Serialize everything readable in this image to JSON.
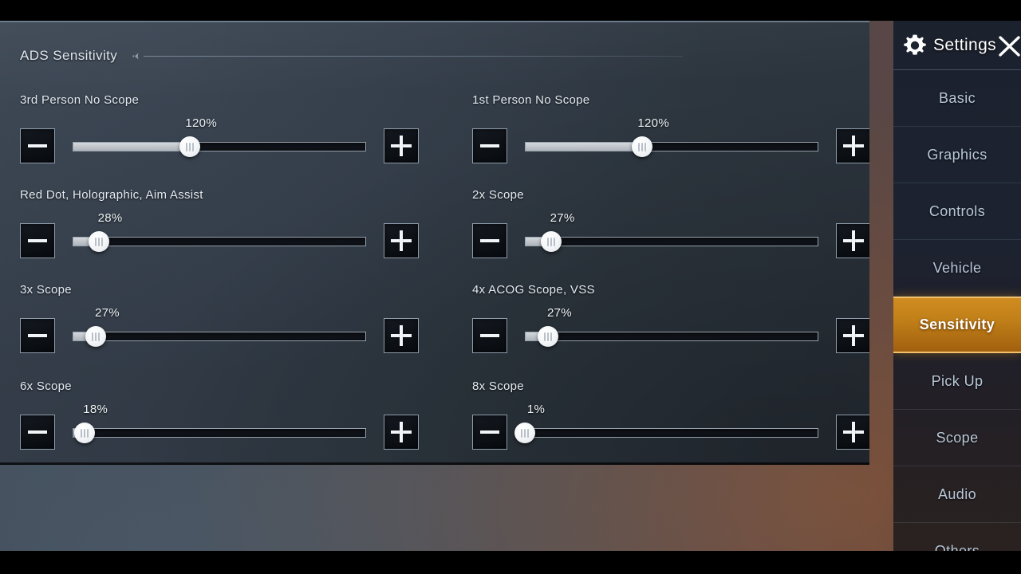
{
  "panel": {
    "section": {
      "title": "ADS Sensitivity",
      "collapse_icon": "chevron-left-icon"
    },
    "settings": [
      {
        "label": "3rd Person No Scope",
        "value": "120%",
        "percent": 40,
        "minus_label": "minus-icon",
        "plus_label": "plus-icon",
        "column": "left"
      },
      {
        "label": "1st Person No Scope",
        "value": "120%",
        "percent": 40,
        "minus_label": "minus-icon",
        "plus_label": "plus-icon",
        "column": "right"
      },
      {
        "label": "Red Dot, Holographic, Aim Assist",
        "value": "28%",
        "percent": 9,
        "minus_label": "minus-icon",
        "plus_label": "plus-icon",
        "column": "left"
      },
      {
        "label": "2x Scope",
        "value": "27%",
        "percent": 9,
        "minus_label": "minus-icon",
        "plus_label": "plus-icon",
        "column": "right"
      },
      {
        "label": "3x Scope",
        "value": "27%",
        "percent": 8,
        "minus_label": "minus-icon",
        "plus_label": "plus-icon",
        "column": "left"
      },
      {
        "label": "4x ACOG Scope, VSS",
        "value": "27%",
        "percent": 8,
        "minus_label": "minus-icon",
        "plus_label": "plus-icon",
        "column": "right"
      },
      {
        "label": "6x Scope",
        "value": "18%",
        "percent": 4,
        "minus_label": "minus-icon",
        "plus_label": "plus-icon",
        "column": "left"
      },
      {
        "label": "8x Scope",
        "value": "1%",
        "percent": 0,
        "minus_label": "minus-icon",
        "plus_label": "plus-icon",
        "column": "right"
      }
    ]
  },
  "sidebar": {
    "title": "Settings",
    "gear_icon": "gear-icon",
    "close_icon": "close-icon",
    "items": [
      {
        "label": "Basic",
        "active": false
      },
      {
        "label": "Graphics",
        "active": false
      },
      {
        "label": "Controls",
        "active": false
      },
      {
        "label": "Vehicle",
        "active": false
      },
      {
        "label": "Sensitivity",
        "active": true
      },
      {
        "label": "Pick Up",
        "active": false
      },
      {
        "label": "Scope",
        "active": false
      },
      {
        "label": "Audio",
        "active": false
      },
      {
        "label": "Others",
        "active": false
      }
    ]
  },
  "colors": {
    "accent": "#c8801a",
    "accent_border": "#f2c06a",
    "panel_bg": "#303944",
    "sidebar_bg": "#1c2230",
    "text": "#e4ebf2",
    "muted_text": "#b9c8d8"
  }
}
